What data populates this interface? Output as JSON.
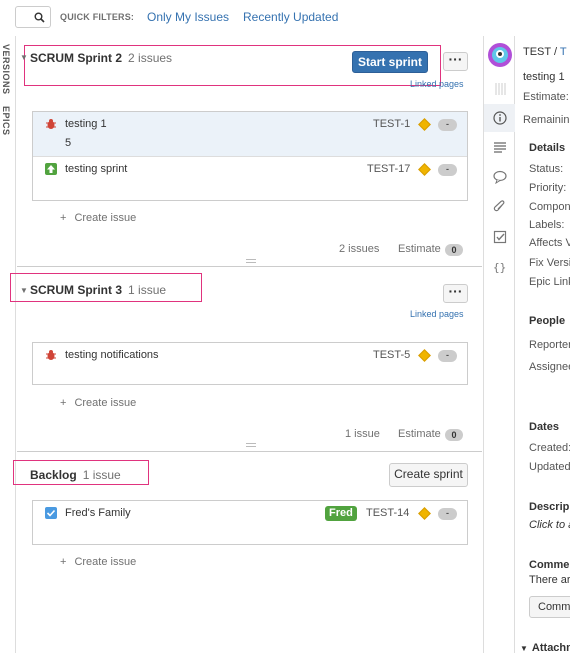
{
  "filters": {
    "label": "QUICK FILTERS:",
    "items": [
      "Only My Issues",
      "Recently Updated"
    ]
  },
  "side_tabs": {
    "versions": "VERSIONS",
    "epics": "EPICS"
  },
  "sprints": [
    {
      "name": "SCRUM Sprint 2",
      "count_label": "2 issues",
      "action_label": "Start sprint",
      "linked_pages": "Linked pages",
      "issues": [
        {
          "type": "bug",
          "summary": "testing 1",
          "extra": "5",
          "key": "TEST-1",
          "priority": "medium",
          "estimate": "-"
        },
        {
          "type": "improvement",
          "summary": "testing sprint",
          "key": "TEST-17",
          "priority": "medium",
          "estimate": "-"
        }
      ],
      "create_issue": "Create issue",
      "footer_count": "2 issues",
      "footer_estimate_label": "Estimate",
      "footer_estimate_value": "0"
    },
    {
      "name": "SCRUM Sprint 3",
      "count_label": "1 issue",
      "linked_pages": "Linked pages",
      "issues": [
        {
          "type": "bug",
          "summary": "testing notifications",
          "key": "TEST-5",
          "priority": "medium",
          "estimate": "-"
        }
      ],
      "create_issue": "Create issue",
      "footer_count": "1 issue",
      "footer_estimate_label": "Estimate",
      "footer_estimate_value": "0"
    }
  ],
  "backlog": {
    "name": "Backlog",
    "count_label": "1 issue",
    "action_label": "Create sprint",
    "issues": [
      {
        "type": "task",
        "summary": "Fred's Family",
        "label": "Fred",
        "key": "TEST-14",
        "priority": "medium",
        "estimate": "-"
      }
    ],
    "create_issue": "Create issue"
  },
  "detail": {
    "breadcrumb_project": "TEST",
    "breadcrumb_sep": "/",
    "breadcrumb_key": "T",
    "summary": "testing 1",
    "estimate_label": "Estimate:",
    "remaining_label": "Remaining",
    "details_heading": "Details",
    "fields": [
      "Status:",
      "Priority:",
      "Compon",
      "Labels:",
      "Affects V",
      "Fix Versi",
      "Epic Link"
    ],
    "people_heading": "People",
    "people_fields": [
      "Reporter",
      "Assignee"
    ],
    "dates_heading": "Dates",
    "date_fields": [
      "Created:",
      "Updated"
    ],
    "description_heading": "Descrip",
    "description_placeholder": "Click to a",
    "comments_heading": "Comme",
    "comments_text": "There ar",
    "comment_button": "Comm",
    "attachments_heading": "Attachm"
  },
  "colors": {
    "accent": "#3572b0",
    "highlight": "#e0337e",
    "label_green": "#51a33f",
    "priority": "#f0b400"
  }
}
